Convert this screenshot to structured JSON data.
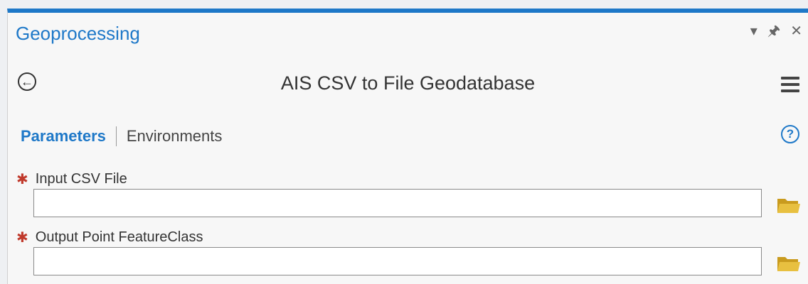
{
  "pane": {
    "title": "Geoprocessing",
    "controls": {
      "dropdown_icon": "chevron-down-icon",
      "pin_icon": "pin-icon",
      "close_icon": "close-icon"
    }
  },
  "tool": {
    "back_icon": "back-arrow-icon",
    "title": "AIS CSV to File Geodatabase",
    "menu_icon": "hamburger-menu-icon"
  },
  "tabs": {
    "parameters": "Parameters",
    "environments": "Environments",
    "help_icon": "help-icon"
  },
  "parameters": [
    {
      "label": "Input CSV File",
      "required": true,
      "value": ""
    },
    {
      "label": "Output Point FeatureClass",
      "required": true,
      "value": ""
    }
  ],
  "colors": {
    "accent": "#1e78c8",
    "required": "#c0392b",
    "folder": "#e8c040"
  }
}
